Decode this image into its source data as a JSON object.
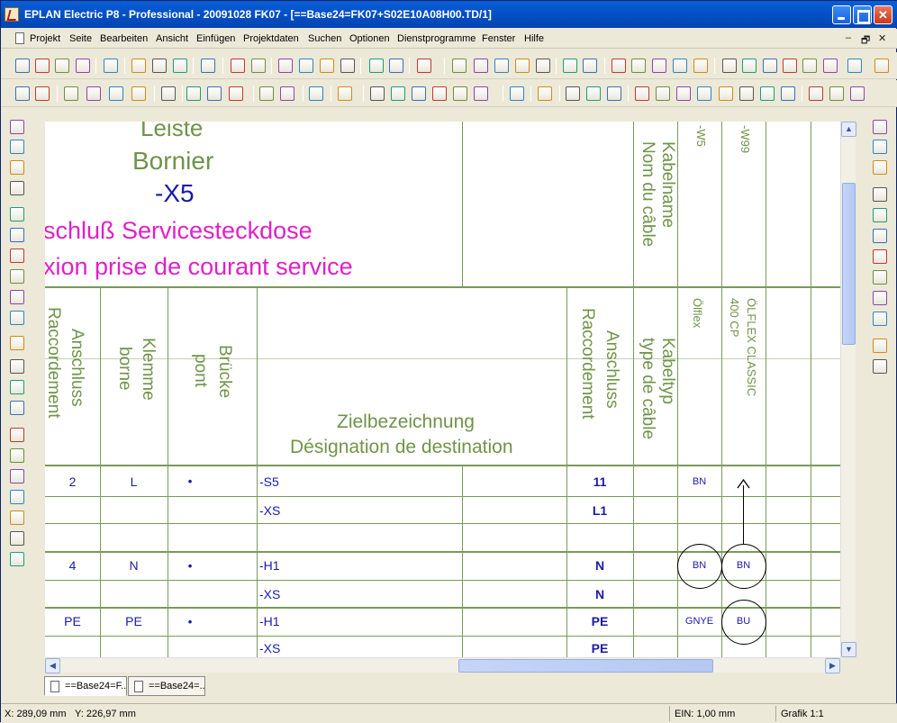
{
  "window": {
    "title": "EPLAN Electric P8 - Professional - 20091028 FK07 - [==Base24=FK07+S02E10A08H00.TD/1]",
    "colors": {
      "titlebar": "#0553c7",
      "drawing_green": "#6f9449",
      "drawing_blue": "#1a1aa8",
      "drawing_magenta": "#e020c8"
    }
  },
  "menu": {
    "items": [
      "Projekt",
      "Seite",
      "Bearbeiten",
      "Ansicht",
      "Einfügen",
      "Projektdaten",
      "Suchen",
      "Optionen",
      "Dienstprogramme",
      "Fenster",
      "Hilfe"
    ],
    "mdi_min": "–",
    "mdi_restore": "🗗",
    "mdi_close": "✕"
  },
  "drawing": {
    "header": {
      "leiste": "Leiste",
      "bornier": "Bornier",
      "terminal_strip": "-X5",
      "function_de": "schluß Servicesteckdose",
      "function_fr": "xion prise de courant service",
      "cable_name_de": "Kabelname",
      "cable_name_fr": "Nom du câble",
      "cable_1_name": "-W5",
      "cable_2_name": "-W99",
      "cable_type_de": "Kabeltyp",
      "cable_type_fr": "type de câble",
      "cable_1_type": "Ölflex",
      "cable_2_type_line1": "ÖLFLEX CLASSIC",
      "cable_2_type_line2": "400 CP"
    },
    "columns": {
      "anschluss_de": "Anschluss",
      "anschluss_fr": "Raccordement",
      "klemme_de": "Klemme",
      "klemme_fr": "borne",
      "bruecke_de": "Brücke",
      "bruecke_fr": "pont",
      "ziel_de": "Zielbezeichnung",
      "ziel_fr": "Désignation de destination",
      "anschluss2_de": "Anschluss",
      "anschluss2_fr": "Raccordement"
    },
    "rows": [
      {
        "anschluss": "2",
        "klemme": "L",
        "bruecke": "•",
        "ziel": "-S5",
        "anschluss2": "11",
        "w5": "BN",
        "w99": ""
      },
      {
        "anschluss": "",
        "klemme": "",
        "bruecke": "",
        "ziel": "-XS",
        "anschluss2": "L1",
        "w5": "",
        "w99": ""
      },
      {
        "anschluss": "",
        "klemme": "",
        "bruecke": "",
        "ziel": "",
        "anschluss2": "",
        "w5": "",
        "w99": ""
      },
      {
        "anschluss": "4",
        "klemme": "N",
        "bruecke": "•",
        "ziel": "-H1",
        "anschluss2": "N",
        "w5": "BN",
        "w99": "BN"
      },
      {
        "anschluss": "",
        "klemme": "",
        "bruecke": "",
        "ziel": "-XS",
        "anschluss2": "N",
        "w5": "",
        "w99": ""
      },
      {
        "anschluss": "PE",
        "klemme": "PE",
        "bruecke": "•",
        "ziel": "-H1",
        "anschluss2": "PE",
        "w5": "GNYE",
        "w99": "BU"
      },
      {
        "anschluss": "",
        "klemme": "",
        "bruecke": "",
        "ziel": "-XS",
        "anschluss2": "PE",
        "w5": "",
        "w99": ""
      }
    ]
  },
  "tabs": [
    {
      "label": "==Base24=F..."
    },
    {
      "label": "==Base24=..."
    }
  ],
  "status": {
    "x": "X: 289,09 mm",
    "y": "Y: 226,97 mm",
    "ein": "EIN: 1,00 mm",
    "grafik": "Grafik 1:1"
  }
}
